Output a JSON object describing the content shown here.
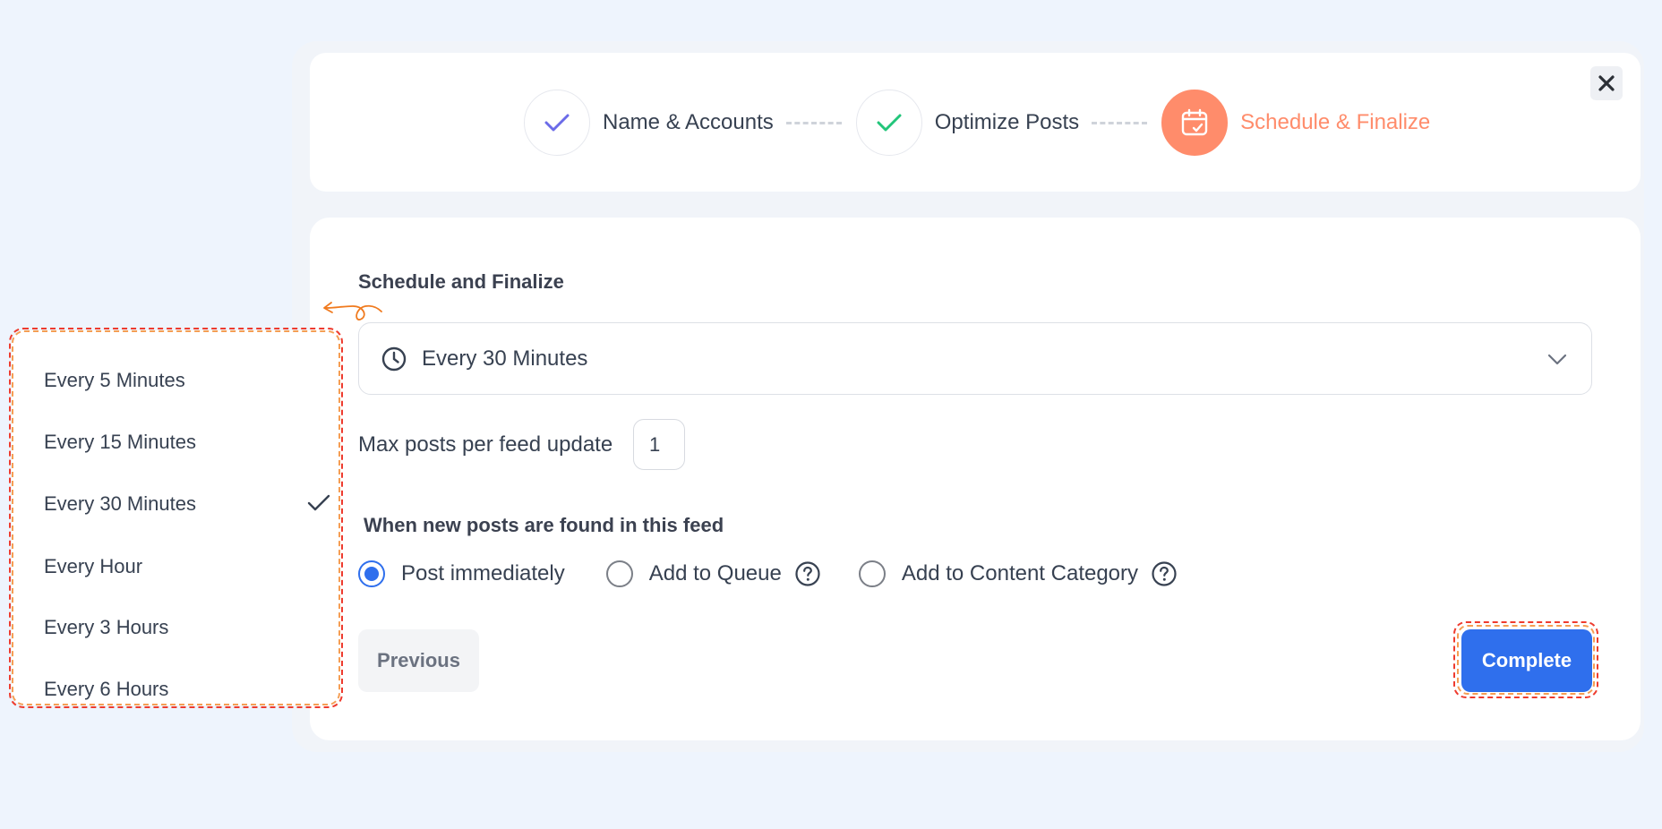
{
  "stepper": {
    "steps": [
      {
        "label": "Name & Accounts",
        "state": "done",
        "check_color": "#6b6be8"
      },
      {
        "label": "Optimize Posts",
        "state": "done",
        "check_color": "#22c57a"
      },
      {
        "label": "Schedule & Finalize",
        "state": "active",
        "color": "#ff8c6b"
      }
    ],
    "close_icon": "close-icon"
  },
  "form": {
    "title": "Schedule and Finalize",
    "frequency": {
      "selected": "Every 30 Minutes",
      "icon": "clock-icon"
    },
    "max_posts": {
      "label": "Max posts per feed update",
      "value": "1"
    },
    "when_new": {
      "label": "When new posts are found in this feed",
      "options": [
        {
          "label": "Post immediately",
          "checked": true
        },
        {
          "label": "Add to Queue",
          "checked": false,
          "help": true
        },
        {
          "label": "Add to Content Category",
          "checked": false,
          "help": true
        }
      ]
    },
    "previous_label": "Previous",
    "complete_label": "Complete"
  },
  "dropdown": {
    "options": [
      "Every 5 Minutes",
      "Every 15 Minutes",
      "Every 30 Minutes",
      "Every Hour",
      "Every 3 Hours",
      "Every 6 Hours"
    ],
    "selected_index": 2
  },
  "colors": {
    "accent": "#2f6fed",
    "active_step": "#ff8c6b",
    "highlight_outer": "#ee3b2e",
    "highlight_inner": "#f59e54"
  }
}
